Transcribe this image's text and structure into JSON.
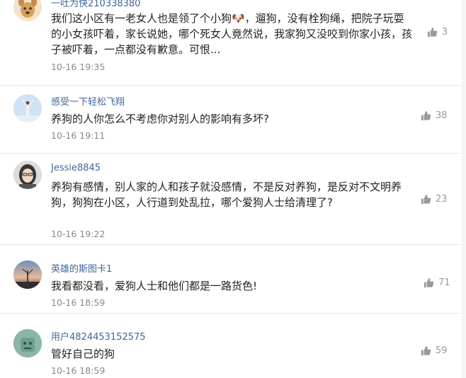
{
  "comments": [
    {
      "username": "一吐为快210338380",
      "text": "我们这小区有一老女人也是领了个小狗🐶，遛狗，没有栓狗绳，把院子玩耍的小女孩吓着，家长说她，哪个死女人竟然说，我家狗又没咬到你家小孩，孩子被吓着，一点都没有歉意。可恨...",
      "time": "10-16 19:35",
      "likes": "3"
    },
    {
      "username": "感受一下轻松飞翔",
      "text": "养狗的人你怎么不考虑你对别人的影响有多坏?",
      "time": "10-16 19:11",
      "likes": "38"
    },
    {
      "username": "Jessie8845",
      "text": "养狗有感情，别人家的人和孩子就没感情，不是反对养狗，是反对不文明养狗，狗狗在小区，人行道到处乱拉，哪个爱狗人士给清理了?",
      "time": "10-16 19:22",
      "likes": "23"
    },
    {
      "username": "英雄的斯图卡1",
      "text": "我看都没看，爱狗人士和他们都是一路货色!",
      "time": "10-16 18:59",
      "likes": "71"
    },
    {
      "username": "用户4824453152575",
      "text": "管好自己的狗",
      "time": "10-16 18:59",
      "likes": "59"
    }
  ],
  "icons": {
    "like": "thumbs-up-icon"
  },
  "colors": {
    "username": "#406599",
    "text": "#222222",
    "meta": "#888888"
  }
}
